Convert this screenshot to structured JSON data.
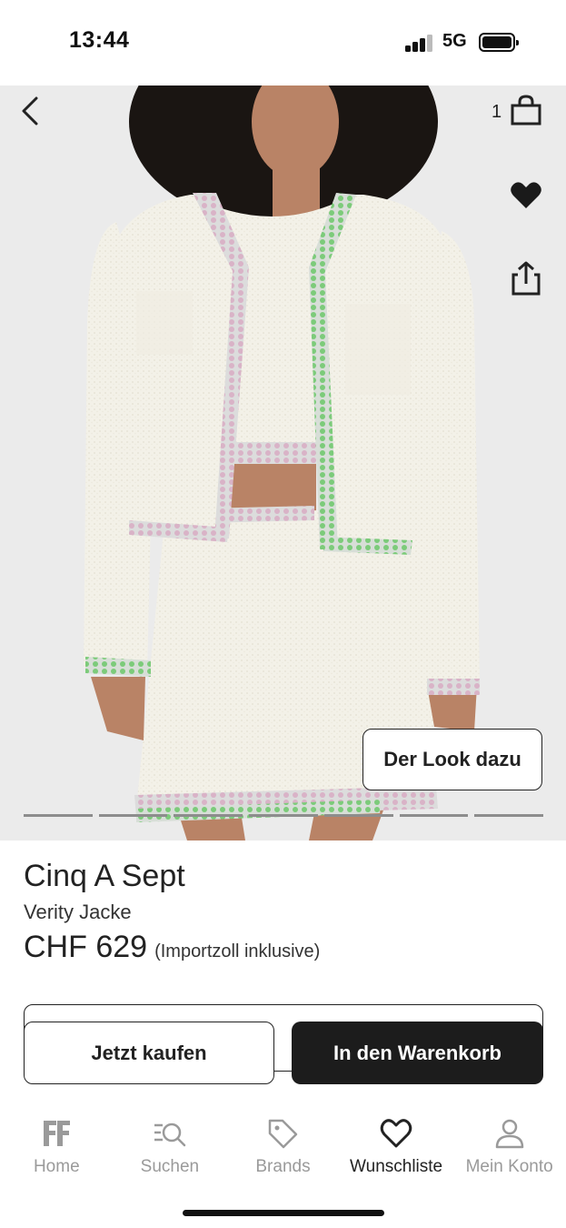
{
  "status_bar": {
    "time": "13:44",
    "network": "5G"
  },
  "header": {
    "cart_count": "1",
    "icons": [
      "back-chevron-icon",
      "shopping-bag-icon",
      "heart-icon",
      "share-icon"
    ]
  },
  "gallery": {
    "look_button": "Der Look dazu",
    "page_count": 7
  },
  "product": {
    "brand": "Cinq A Sept",
    "name": "Verity Jacke",
    "price": "CHF 629",
    "price_note": "(Importzoll inklusive)"
  },
  "actions": {
    "buy_now": "Jetzt kaufen",
    "add_to_cart": "In den Warenkorb"
  },
  "tabbar": {
    "items": [
      {
        "label": "Home",
        "icon": "farfetch-logo-icon"
      },
      {
        "label": "Suchen",
        "icon": "search-icon"
      },
      {
        "label": "Brands",
        "icon": "tag-icon"
      },
      {
        "label": "Wunschliste",
        "icon": "heart-outline-icon"
      },
      {
        "label": "Mein Konto",
        "icon": "user-icon"
      }
    ],
    "active": "Wunschliste"
  },
  "colors": {
    "accent": "#1c1c1c",
    "background": "#ebebeb",
    "inactive_tab": "#9a9a9a"
  }
}
